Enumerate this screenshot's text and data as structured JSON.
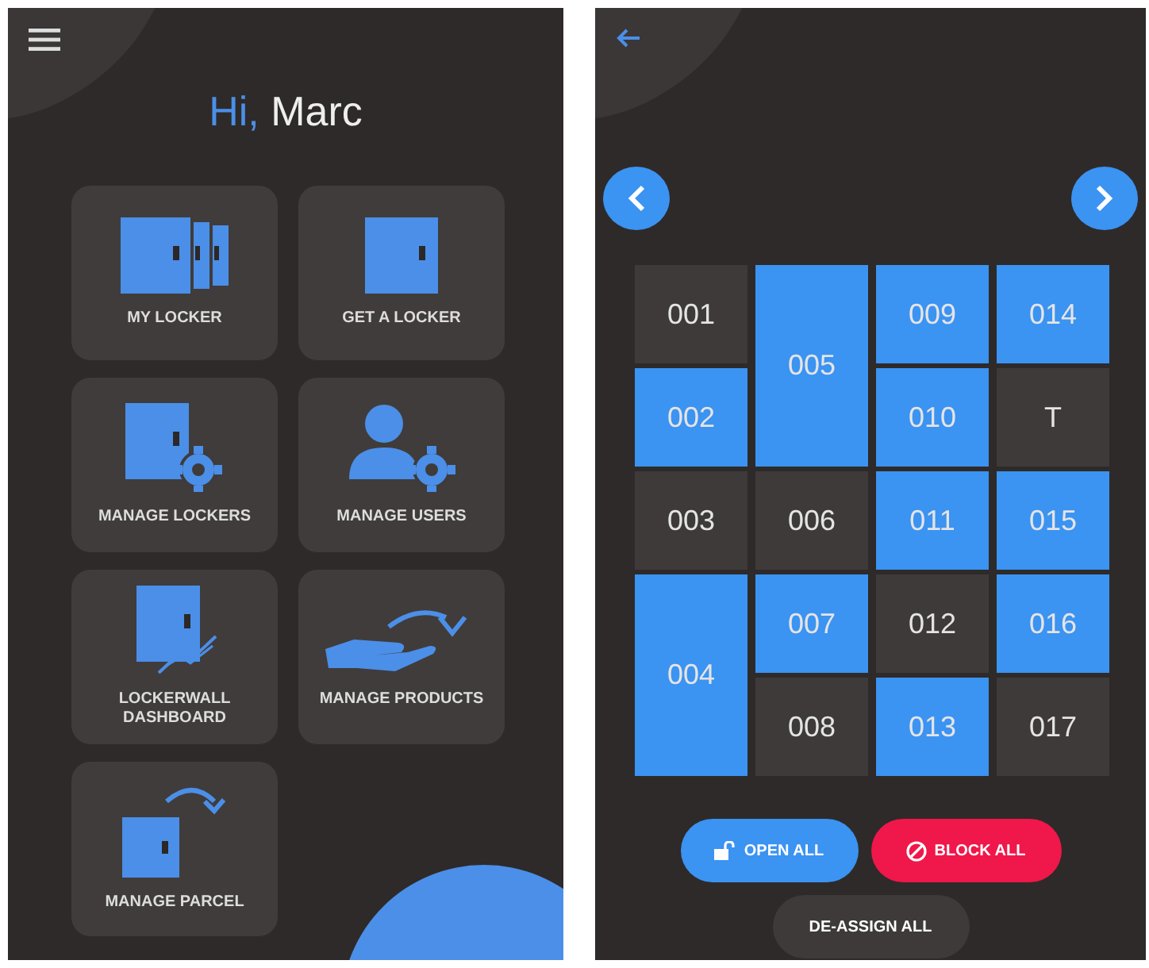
{
  "home": {
    "greeting": {
      "salutation": "Hi,",
      "name": "Marc"
    },
    "tiles": [
      {
        "kind": "lockers",
        "label": "MY LOCKER"
      },
      {
        "kind": "locker",
        "label": "GET A LOCKER"
      },
      {
        "kind": "locker-gear",
        "label": "MANAGE LOCKERS"
      },
      {
        "kind": "user-gear",
        "label": "MANAGE USERS"
      },
      {
        "kind": "locker-chart",
        "label": "LOCKERWALL DASHBOARD"
      },
      {
        "kind": "hand-arrow",
        "label": "MANAGE PRODUCTS"
      },
      {
        "kind": "locker-arrow",
        "label": "MANAGE PARCEL"
      }
    ]
  },
  "locker_wall": {
    "columns": [
      {
        "lockers": [
          {
            "label": "001",
            "kind": "single",
            "active": false
          },
          {
            "label": "002",
            "kind": "single",
            "active": true
          },
          {
            "label": "003",
            "kind": "single",
            "active": false
          },
          {
            "label": "004",
            "kind": "double",
            "active": true
          }
        ]
      },
      {
        "lockers": [
          {
            "label": "005",
            "kind": "double",
            "active": true
          },
          {
            "label": "006",
            "kind": "single",
            "active": false
          },
          {
            "label": "007",
            "kind": "single",
            "active": true
          },
          {
            "label": "008",
            "kind": "single",
            "active": false
          }
        ]
      },
      {
        "lockers": [
          {
            "label": "009",
            "kind": "single",
            "active": true
          },
          {
            "label": "010",
            "kind": "single",
            "active": true
          },
          {
            "label": "011",
            "kind": "single",
            "active": true
          },
          {
            "label": "012",
            "kind": "single",
            "active": false
          },
          {
            "label": "013",
            "kind": "single",
            "active": true
          }
        ]
      },
      {
        "lockers": [
          {
            "label": "014",
            "kind": "single",
            "active": true
          },
          {
            "label": "T",
            "kind": "single",
            "active": false
          },
          {
            "label": "015",
            "kind": "single",
            "active": true
          },
          {
            "label": "016",
            "kind": "single",
            "active": true
          },
          {
            "label": "017",
            "kind": "single",
            "active": false
          }
        ]
      }
    ],
    "actions": [
      {
        "kind": "open",
        "label": "OPEN ALL"
      },
      {
        "kind": "block",
        "label": "BLOCK ALL"
      },
      {
        "kind": "deassign",
        "label": "DE-ASSIGN ALL"
      }
    ]
  }
}
